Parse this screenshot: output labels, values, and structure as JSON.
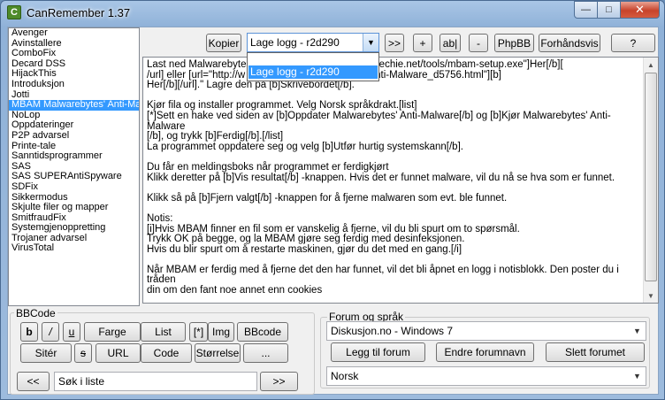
{
  "window": {
    "title": "CanRemember 1.37"
  },
  "list": {
    "items": [
      "Avenger",
      "Avinstallere",
      "ComboFix",
      "Decard DSS",
      "HijackThis",
      "Introduksjon",
      "Jotti",
      "MBAM Malwarebytes' Anti-Malware",
      "NoLop",
      "Oppdateringer",
      "P2P advarsel",
      "Printe-tale",
      "Sanntidsprogrammer",
      "SAS",
      "SAS SUPERAntiSpyware",
      "SDFix",
      "Sikkermodus",
      "Skjulte filer og mapper",
      "SmitfraudFix",
      "Systemgjenoppretting",
      "Trojaner advarsel",
      "VirusTotal"
    ],
    "selected_index": 7
  },
  "toolbar": {
    "copy": "Kopier",
    "log_select_value": "Lage logg - r2d290",
    "next": ">>",
    "add": "+",
    "ab": "ab|",
    "remove": "-",
    "phpbb": "PhpBB",
    "preview": "Forhåndsvis",
    "help": "?"
  },
  "dropdown": {
    "option": "Lage logg - r2d290"
  },
  "text": {
    "content": "Last ned Malwarebytes                                  w.besttechie.net/tools/mbam-setup.exe\"]Her[/b][\n/url] eller [url=\"http://w                                   ytes_Anti-Malware_d5756.html\"][b]\nHer[/b][/url].\" Lagre den på [b]Skrivebordet[/b].\n\nKjør fila og installer programmet. Velg Norsk språkdrakt.[list]\n[*]Sett en hake ved siden av [b]Oppdater Malwarebytes' Anti-Malware[/b] og [b]Kjør Malwarebytes' Anti-Malware\n[/b], og trykk [b]Ferdig[/b].[/list]\nLa programmet oppdatere seg og velg [b]Utfør hurtig systemskann[/b].\n\nDu får en meldingsboks når programmet er ferdigkjørt\nKlikk deretter på [b]Vis resultat[/b] -knappen. Hvis det er funnet malware, vil du nå se hva som er funnet.\n\nKlikk så på [b]Fjern valgt[/b] -knappen for å fjerne malwaren som evt. ble funnet.\n\nNotis:\n[i]Hvis MBAM finner en fil som er vanskelig å fjerne, vil du bli spurt om to spørsmål.\nTrykk OK på begge, og la MBAM gjøre seg ferdig med desinfeksjonen.\nHvis du blir spurt om å restarte maskinen, gjør du det med en gang.[/i]\n\nNår MBAM er ferdig med å fjerne det den har funnet, vil det bli åpnet en logg i notisblokk. Den poster du i tråden\ndin om den fant noe annet enn cookies"
  },
  "bbcode": {
    "label": "BBCode",
    "bold": "b",
    "italic": "/",
    "underline": "u",
    "color": "Farge",
    "list": "List",
    "list_item": "[*]",
    "img": "Img",
    "bbcode": "BBcode",
    "quote": "Sitér",
    "strike": "s",
    "url": "URL",
    "code": "Code",
    "size": "Størrelse",
    "more": "...",
    "prev": "<<",
    "search_value": "Søk i liste",
    "next": ">>"
  },
  "forum": {
    "label": "Forum og språk",
    "forum_value": "Diskusjon.no - Windows 7",
    "add": "Legg til forum",
    "rename": "Endre forumnavn",
    "delete": "Slett forumet",
    "language_value": "Norsk"
  }
}
